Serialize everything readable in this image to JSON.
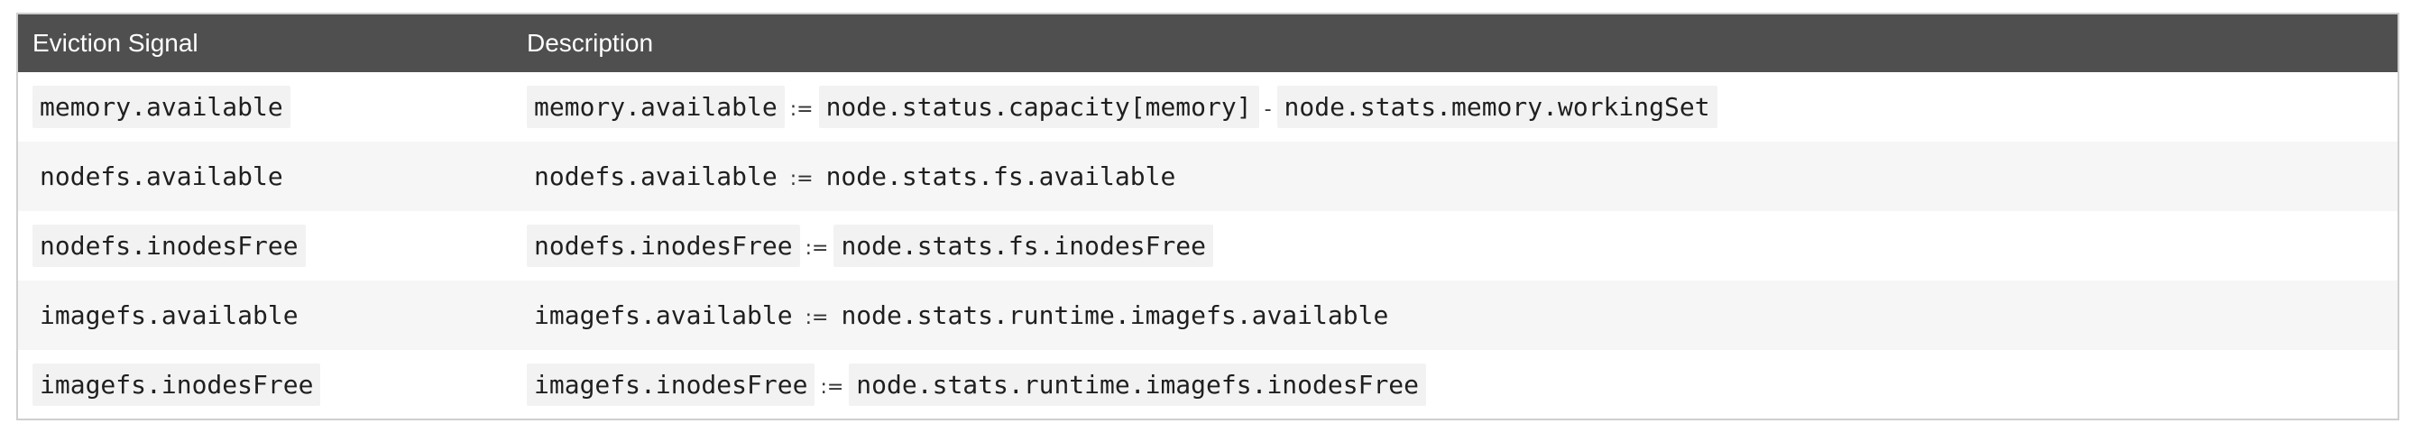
{
  "table": {
    "headers": {
      "signal": "Eviction Signal",
      "description": "Description"
    },
    "rows": [
      {
        "signal": "memory.available",
        "lhs": "memory.available",
        "assign": ":=",
        "rhs": "node.status.capacity[memory]",
        "minus": "-",
        "rhs2": "node.stats.memory.workingSet"
      },
      {
        "signal": "nodefs.available",
        "lhs": "nodefs.available",
        "assign": ":=",
        "rhs": "node.stats.fs.available"
      },
      {
        "signal": "nodefs.inodesFree",
        "lhs": "nodefs.inodesFree",
        "assign": ":=",
        "rhs": "node.stats.fs.inodesFree"
      },
      {
        "signal": "imagefs.available",
        "lhs": "imagefs.available",
        "assign": ":=",
        "rhs": "node.stats.runtime.imagefs.available"
      },
      {
        "signal": "imagefs.inodesFree",
        "lhs": "imagefs.inodesFree",
        "assign": ":=",
        "rhs": "node.stats.runtime.imagefs.inodesFree"
      }
    ]
  }
}
